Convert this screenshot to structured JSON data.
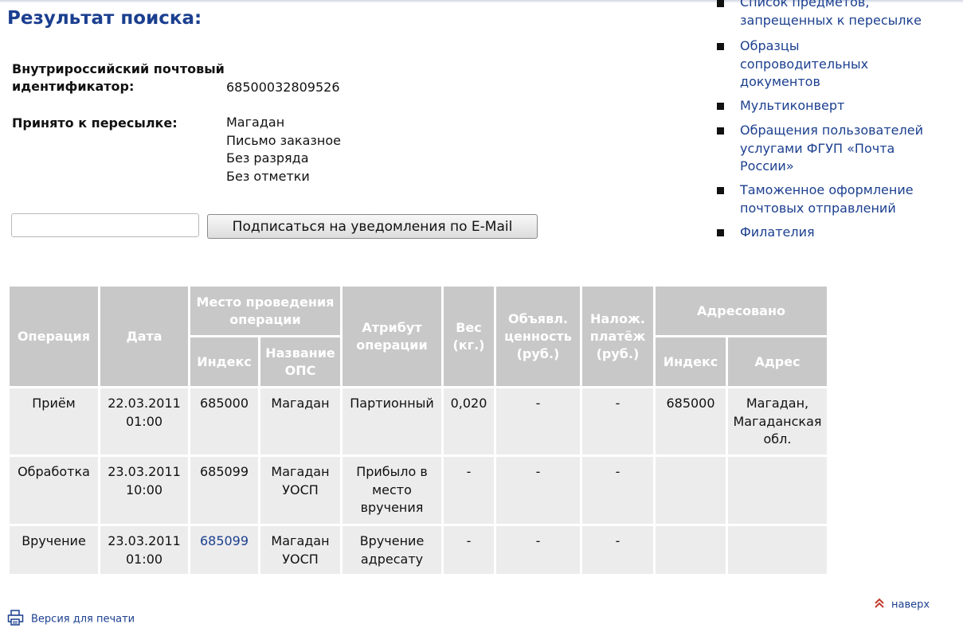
{
  "result": {
    "title": "Результат поиска:",
    "id_label": "Внутрироссийский почтовый идентификатор:",
    "id_value": "68500032809526",
    "accepted_label": "Принято к пересылке:",
    "accepted_values": [
      "Магадан",
      "Письмо заказное",
      "Без разряда",
      "Без отметки"
    ]
  },
  "subscribe": {
    "email_value": "",
    "button_label": "Подписаться на уведомления по E-Mail"
  },
  "side_menu": {
    "items": [
      {
        "lines": [
          "Список предметов,",
          "запрещенных к пересылке"
        ]
      },
      {
        "lines": [
          "Образцы",
          "сопроводительных",
          "документов"
        ]
      },
      {
        "lines": [
          "Мультиконверт"
        ]
      },
      {
        "lines": [
          "Обращения пользователей",
          "услугами ФГУП «Почта",
          "России»"
        ]
      },
      {
        "lines": [
          "Таможенное оформление",
          "почтовых отправлений"
        ]
      },
      {
        "lines": [
          "Филателия"
        ]
      }
    ]
  },
  "table": {
    "headers": {
      "operation": "Операция",
      "date": "Дата",
      "place": "Место проведения операции",
      "index": "Индекс",
      "ops_name": "Название ОПС",
      "attribute": "Атрибут операции",
      "weight": "Вес (кг.)",
      "declared": "Объявл. ценность (руб.)",
      "cod": "Налож. платёж (руб.)",
      "addressed": "Адресовано",
      "addr_index": "Индекс",
      "address": "Адрес"
    },
    "rows": [
      {
        "operation": "Приём",
        "date": "22.03.2011",
        "time": "01:00",
        "index": "685000",
        "index_link": false,
        "ops_name": "Магадан",
        "attribute": "Партионный",
        "weight": "0,020",
        "declared": "-",
        "cod": "-",
        "addr_index": "685000",
        "address": "Магадан, Магаданская обл."
      },
      {
        "operation": "Обработка",
        "date": "23.03.2011",
        "time": "10:00",
        "index": "685099",
        "index_link": false,
        "ops_name": "Магадан УОСП",
        "attribute": "Прибыло в место вручения",
        "weight": "-",
        "declared": "-",
        "cod": "-",
        "addr_index": "",
        "address": ""
      },
      {
        "operation": "Вручение",
        "date": "23.03.2011",
        "time": "01:00",
        "index": "685099",
        "index_link": true,
        "ops_name": "Магадан УОСП",
        "attribute": "Вручение адресату",
        "weight": "-",
        "declared": "-",
        "cod": "-",
        "addr_index": "",
        "address": ""
      }
    ]
  },
  "footer": {
    "print_label": "Версия для печати",
    "top_label": "наверх"
  },
  "colors": {
    "title_blue": "#1b3f8f",
    "header_gray": "#c8c8c8",
    "cell_gray": "#ececec",
    "accent_red": "#c0392b"
  },
  "icons": {
    "print": "printer-icon",
    "top": "double-chevron-up-icon",
    "bullet": "square-bullet-icon"
  }
}
